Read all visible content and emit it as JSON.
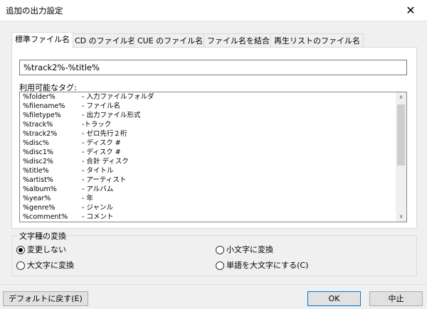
{
  "window": {
    "title": "追加の出力設定",
    "close_glyph": "✕"
  },
  "tabs": [
    {
      "label": "標準ファイル名"
    },
    {
      "label": "CD のファイル名"
    },
    {
      "label": "CUE のファイル名"
    },
    {
      "label": "ファイル名を結合"
    },
    {
      "label": "再生リストのファイル名"
    }
  ],
  "format": {
    "value": "%track2%-%title%"
  },
  "tags": {
    "label": "利用可能なタグ:",
    "items": [
      {
        "tag": "%folder%",
        "desc": "- 入力ファイルフォルダ"
      },
      {
        "tag": "%filename%",
        "desc": "- ファイル名"
      },
      {
        "tag": "%filetype%",
        "desc": "- 出力ファイル形式"
      },
      {
        "tag": "%track%",
        "desc": "-トラック"
      },
      {
        "tag": "%track2%",
        "desc": "- ゼロ先行２桁"
      },
      {
        "tag": "%disc%",
        "desc": "- ディスク #"
      },
      {
        "tag": "%disc1%",
        "desc": "- ディスク #"
      },
      {
        "tag": "%disc2%",
        "desc": "- 合計 ディスク"
      },
      {
        "tag": "%title%",
        "desc": "- タイトル"
      },
      {
        "tag": "%artist%",
        "desc": "- アーティスト"
      },
      {
        "tag": "%album%",
        "desc": "- アルバム"
      },
      {
        "tag": "%year%",
        "desc": "- 年"
      },
      {
        "tag": "%genre%",
        "desc": "- ジャンル"
      },
      {
        "tag": "%comment%",
        "desc": "- コメント"
      }
    ]
  },
  "case_group": {
    "label": "文字種の変換",
    "options": [
      {
        "label": "変更しない",
        "checked": true
      },
      {
        "label": "小文字に変換",
        "checked": false
      },
      {
        "label": "大文字に変換",
        "checked": false
      },
      {
        "label": "単語を大文字にする(C)",
        "checked": false
      }
    ]
  },
  "buttons": {
    "reset": "デフォルトに戻す(E)",
    "ok": "OK",
    "cancel": "中止"
  },
  "scroll_icons": {
    "up": "∧",
    "down": "∨"
  }
}
